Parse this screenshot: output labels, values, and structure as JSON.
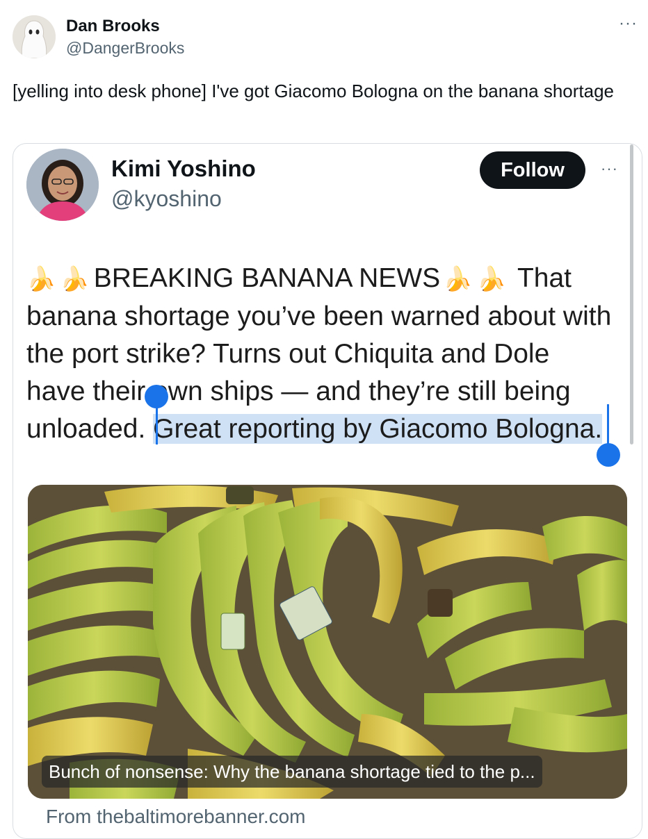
{
  "outer_tweet": {
    "author_name": "Dan Brooks",
    "author_handle": "@DangerBrooks",
    "more_icon": "···",
    "text": "[yelling into desk phone] I've got Giacomo Bologna on the banana shortage"
  },
  "embedded_tweet": {
    "author_name": "Kimi Yoshino",
    "author_handle": "@kyoshino",
    "follow_label": "Follow",
    "more_icon": "···",
    "banana_emoji": "🍌",
    "headline": "BREAKING BANANA NEWS",
    "body_line1_tail": "That",
    "body_line2": "banana shortage you’ve been warned about with",
    "body_line3": "the port strike? Turns out Chiquita and Dole",
    "body_line4": "have their own ships — and they’re still being",
    "body_line5_unselected": "unloaded. ",
    "body_line5_selected": "Great reporting by Giacomo Bologna.",
    "link_card": {
      "caption": "Bunch of nonsense: Why the banana shortage tied to the p...",
      "source": "From thebaltimorebanner.com"
    }
  },
  "colors": {
    "selection_highlight": "#cfe1f5",
    "selection_handle": "#1a73e8",
    "follow_button_bg": "#0f1419",
    "secondary_text": "#536471"
  }
}
